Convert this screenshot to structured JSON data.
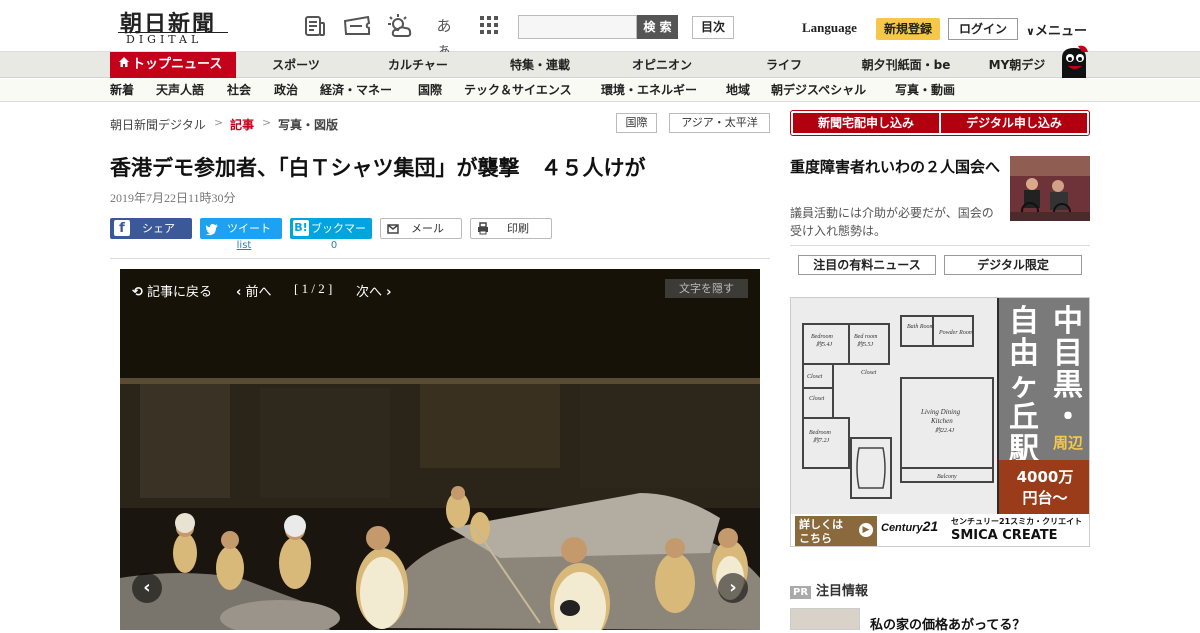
{
  "header": {
    "logo_main": "朝日新聞",
    "logo_sub": "DIGITAL",
    "search_button": "検 索",
    "index_button": "目次",
    "language": "Language",
    "signup": "新規登録",
    "login": "ログイン",
    "menu": "メニュー",
    "icon_aa": "あぁ"
  },
  "nav_primary": {
    "active": "トップニュース",
    "items": [
      "スポーツ",
      "カルチャー",
      "特集・連載",
      "オピニオン",
      "ライフ",
      "朝夕刊紙面・be",
      "MY朝デジ"
    ]
  },
  "nav_secondary": {
    "items": [
      "新着",
      "天声人語",
      "社会",
      "政治",
      "経済・マネー",
      "国際",
      "テック＆サイエンス",
      "環境・エネルギー",
      "地域",
      "朝デジスペシャル",
      "写真・動画"
    ]
  },
  "breadcrumb": [
    "朝日新聞デジタル",
    "記事",
    "写真・図版"
  ],
  "tags": [
    "国際",
    "アジア・太平洋"
  ],
  "article": {
    "title": "香港デモ参加者、「白Ｔシャツ集団」が襲撃　４５人けが",
    "date": "2019年7月22日11時30分"
  },
  "share": {
    "facebook": "シェア",
    "twitter": "ツイート",
    "twitter_sub": "list",
    "hatena": "ブックマーク",
    "hatena_count": "0",
    "mail": "メール",
    "print": "印刷"
  },
  "photo_viewer": {
    "back": "記事に戻る",
    "prev": "前へ",
    "page": "[ 1 / 2 ]",
    "next": "次へ",
    "hide_text": "文字を隠す"
  },
  "sidebar": {
    "subscribe_home": "新聞宅配申し込み",
    "subscribe_digital": "デジタル申し込み",
    "featured_title": "重度障害者れいわの２人国会へ",
    "featured_desc": "議員活動には介助が必要だが、国会の受け入れ態勢は。",
    "tab_paid": "注目の有料ニュース",
    "tab_digital": "デジタル限定",
    "pr_badge": "PR",
    "pr_heading": "注目情報",
    "pr_item": "私の家の価格あがってる？"
  },
  "ad": {
    "headline": "中目黒・自由ヶ丘駅",
    "area": "周辺",
    "price": "4000万円台〜",
    "cta": "詳しくはこちら",
    "brand": "CENTURY 21",
    "company_jp": "センチュリー21スミカ・クリエイト",
    "company_en": "SMICA CREATE",
    "rooms": [
      "Bedroom",
      "Bed room",
      "Bath Room",
      "Powder Room",
      "Closet",
      "Closet",
      "Closet",
      "Bedroom",
      "Living Dining Kitchen",
      "Balcony"
    ],
    "room_sizes": [
      "約5.4J",
      "約5.5J",
      "約7.2J",
      "約22.4J"
    ]
  },
  "colors": {
    "brand_red": "#c4001a",
    "signup_yellow": "#f6c84a",
    "facebook": "#3b5998",
    "twitter": "#1da1f2",
    "hatena": "#00a4de"
  }
}
